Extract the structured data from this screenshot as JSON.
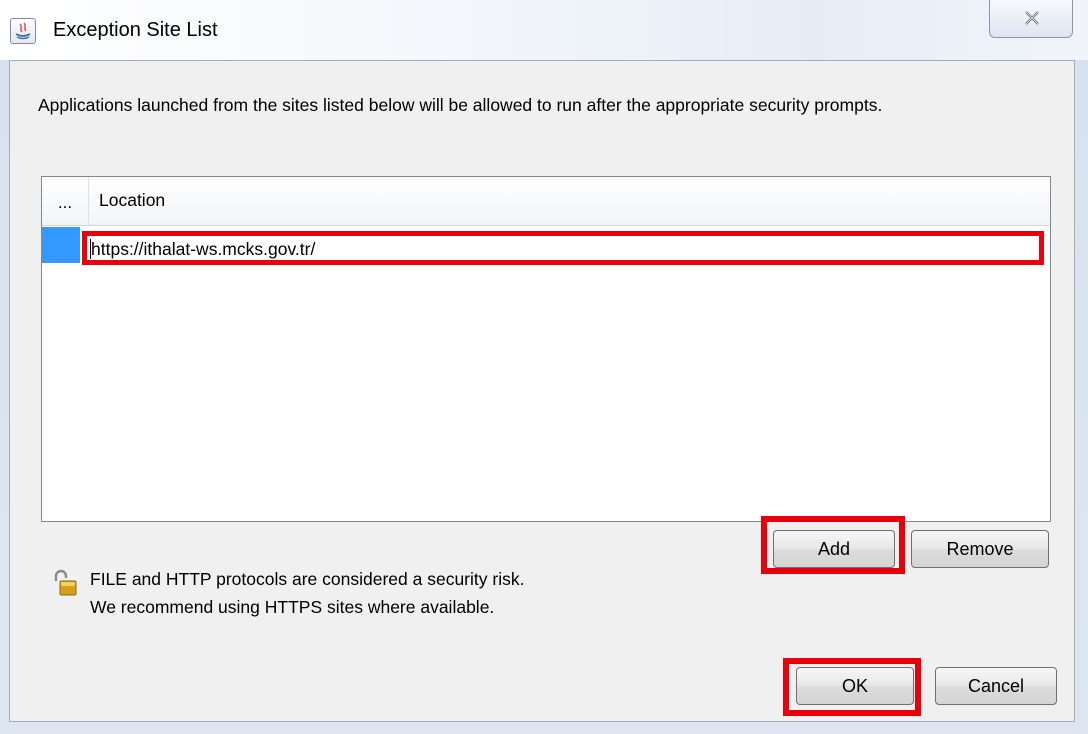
{
  "window": {
    "title": "Exception Site List",
    "icon": "java-icon",
    "close_icon": "close-icon"
  },
  "description": "Applications launched from the sites listed below will be allowed to run after the appropriate security prompts.",
  "table": {
    "columns": [
      "...",
      "Location"
    ],
    "rows": [
      {
        "location": "https://ithalat-ws.mcks.gov.tr/"
      }
    ]
  },
  "buttons": {
    "add": "Add",
    "remove": "Remove",
    "ok": "OK",
    "cancel": "Cancel"
  },
  "warning": {
    "icon": "unlocked-padlock-icon",
    "line1": "FILE and HTTP protocols are considered a security risk.",
    "line2": "We recommend using HTTPS sites where available."
  },
  "colors": {
    "highlight": "#e8000b",
    "selection": "#3399ff"
  }
}
